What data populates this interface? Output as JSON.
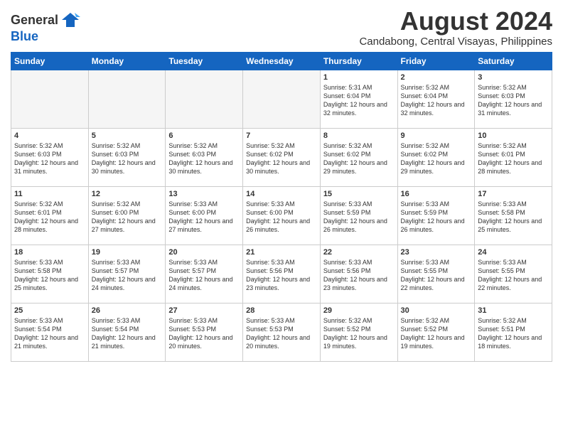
{
  "header": {
    "logo_general": "General",
    "logo_blue": "Blue",
    "month_year": "August 2024",
    "location": "Candabong, Central Visayas, Philippines"
  },
  "weekdays": [
    "Sunday",
    "Monday",
    "Tuesday",
    "Wednesday",
    "Thursday",
    "Friday",
    "Saturday"
  ],
  "weeks": [
    [
      {
        "day": "",
        "sunrise": "",
        "sunset": "",
        "daylight": "",
        "empty": true
      },
      {
        "day": "",
        "sunrise": "",
        "sunset": "",
        "daylight": "",
        "empty": true
      },
      {
        "day": "",
        "sunrise": "",
        "sunset": "",
        "daylight": "",
        "empty": true
      },
      {
        "day": "",
        "sunrise": "",
        "sunset": "",
        "daylight": "",
        "empty": true
      },
      {
        "day": "1",
        "sunrise": "Sunrise: 5:31 AM",
        "sunset": "Sunset: 6:04 PM",
        "daylight": "Daylight: 12 hours and 32 minutes.",
        "empty": false
      },
      {
        "day": "2",
        "sunrise": "Sunrise: 5:32 AM",
        "sunset": "Sunset: 6:04 PM",
        "daylight": "Daylight: 12 hours and 32 minutes.",
        "empty": false
      },
      {
        "day": "3",
        "sunrise": "Sunrise: 5:32 AM",
        "sunset": "Sunset: 6:03 PM",
        "daylight": "Daylight: 12 hours and 31 minutes.",
        "empty": false
      }
    ],
    [
      {
        "day": "4",
        "sunrise": "Sunrise: 5:32 AM",
        "sunset": "Sunset: 6:03 PM",
        "daylight": "Daylight: 12 hours and 31 minutes.",
        "empty": false
      },
      {
        "day": "5",
        "sunrise": "Sunrise: 5:32 AM",
        "sunset": "Sunset: 6:03 PM",
        "daylight": "Daylight: 12 hours and 30 minutes.",
        "empty": false
      },
      {
        "day": "6",
        "sunrise": "Sunrise: 5:32 AM",
        "sunset": "Sunset: 6:03 PM",
        "daylight": "Daylight: 12 hours and 30 minutes.",
        "empty": false
      },
      {
        "day": "7",
        "sunrise": "Sunrise: 5:32 AM",
        "sunset": "Sunset: 6:02 PM",
        "daylight": "Daylight: 12 hours and 30 minutes.",
        "empty": false
      },
      {
        "day": "8",
        "sunrise": "Sunrise: 5:32 AM",
        "sunset": "Sunset: 6:02 PM",
        "daylight": "Daylight: 12 hours and 29 minutes.",
        "empty": false
      },
      {
        "day": "9",
        "sunrise": "Sunrise: 5:32 AM",
        "sunset": "Sunset: 6:02 PM",
        "daylight": "Daylight: 12 hours and 29 minutes.",
        "empty": false
      },
      {
        "day": "10",
        "sunrise": "Sunrise: 5:32 AM",
        "sunset": "Sunset: 6:01 PM",
        "daylight": "Daylight: 12 hours and 28 minutes.",
        "empty": false
      }
    ],
    [
      {
        "day": "11",
        "sunrise": "Sunrise: 5:32 AM",
        "sunset": "Sunset: 6:01 PM",
        "daylight": "Daylight: 12 hours and 28 minutes.",
        "empty": false
      },
      {
        "day": "12",
        "sunrise": "Sunrise: 5:32 AM",
        "sunset": "Sunset: 6:00 PM",
        "daylight": "Daylight: 12 hours and 27 minutes.",
        "empty": false
      },
      {
        "day": "13",
        "sunrise": "Sunrise: 5:33 AM",
        "sunset": "Sunset: 6:00 PM",
        "daylight": "Daylight: 12 hours and 27 minutes.",
        "empty": false
      },
      {
        "day": "14",
        "sunrise": "Sunrise: 5:33 AM",
        "sunset": "Sunset: 6:00 PM",
        "daylight": "Daylight: 12 hours and 26 minutes.",
        "empty": false
      },
      {
        "day": "15",
        "sunrise": "Sunrise: 5:33 AM",
        "sunset": "Sunset: 5:59 PM",
        "daylight": "Daylight: 12 hours and 26 minutes.",
        "empty": false
      },
      {
        "day": "16",
        "sunrise": "Sunrise: 5:33 AM",
        "sunset": "Sunset: 5:59 PM",
        "daylight": "Daylight: 12 hours and 26 minutes.",
        "empty": false
      },
      {
        "day": "17",
        "sunrise": "Sunrise: 5:33 AM",
        "sunset": "Sunset: 5:58 PM",
        "daylight": "Daylight: 12 hours and 25 minutes.",
        "empty": false
      }
    ],
    [
      {
        "day": "18",
        "sunrise": "Sunrise: 5:33 AM",
        "sunset": "Sunset: 5:58 PM",
        "daylight": "Daylight: 12 hours and 25 minutes.",
        "empty": false
      },
      {
        "day": "19",
        "sunrise": "Sunrise: 5:33 AM",
        "sunset": "Sunset: 5:57 PM",
        "daylight": "Daylight: 12 hours and 24 minutes.",
        "empty": false
      },
      {
        "day": "20",
        "sunrise": "Sunrise: 5:33 AM",
        "sunset": "Sunset: 5:57 PM",
        "daylight": "Daylight: 12 hours and 24 minutes.",
        "empty": false
      },
      {
        "day": "21",
        "sunrise": "Sunrise: 5:33 AM",
        "sunset": "Sunset: 5:56 PM",
        "daylight": "Daylight: 12 hours and 23 minutes.",
        "empty": false
      },
      {
        "day": "22",
        "sunrise": "Sunrise: 5:33 AM",
        "sunset": "Sunset: 5:56 PM",
        "daylight": "Daylight: 12 hours and 23 minutes.",
        "empty": false
      },
      {
        "day": "23",
        "sunrise": "Sunrise: 5:33 AM",
        "sunset": "Sunset: 5:55 PM",
        "daylight": "Daylight: 12 hours and 22 minutes.",
        "empty": false
      },
      {
        "day": "24",
        "sunrise": "Sunrise: 5:33 AM",
        "sunset": "Sunset: 5:55 PM",
        "daylight": "Daylight: 12 hours and 22 minutes.",
        "empty": false
      }
    ],
    [
      {
        "day": "25",
        "sunrise": "Sunrise: 5:33 AM",
        "sunset": "Sunset: 5:54 PM",
        "daylight": "Daylight: 12 hours and 21 minutes.",
        "empty": false
      },
      {
        "day": "26",
        "sunrise": "Sunrise: 5:33 AM",
        "sunset": "Sunset: 5:54 PM",
        "daylight": "Daylight: 12 hours and 21 minutes.",
        "empty": false
      },
      {
        "day": "27",
        "sunrise": "Sunrise: 5:33 AM",
        "sunset": "Sunset: 5:53 PM",
        "daylight": "Daylight: 12 hours and 20 minutes.",
        "empty": false
      },
      {
        "day": "28",
        "sunrise": "Sunrise: 5:33 AM",
        "sunset": "Sunset: 5:53 PM",
        "daylight": "Daylight: 12 hours and 20 minutes.",
        "empty": false
      },
      {
        "day": "29",
        "sunrise": "Sunrise: 5:32 AM",
        "sunset": "Sunset: 5:52 PM",
        "daylight": "Daylight: 12 hours and 19 minutes.",
        "empty": false
      },
      {
        "day": "30",
        "sunrise": "Sunrise: 5:32 AM",
        "sunset": "Sunset: 5:52 PM",
        "daylight": "Daylight: 12 hours and 19 minutes.",
        "empty": false
      },
      {
        "day": "31",
        "sunrise": "Sunrise: 5:32 AM",
        "sunset": "Sunset: 5:51 PM",
        "daylight": "Daylight: 12 hours and 18 minutes.",
        "empty": false
      }
    ]
  ]
}
